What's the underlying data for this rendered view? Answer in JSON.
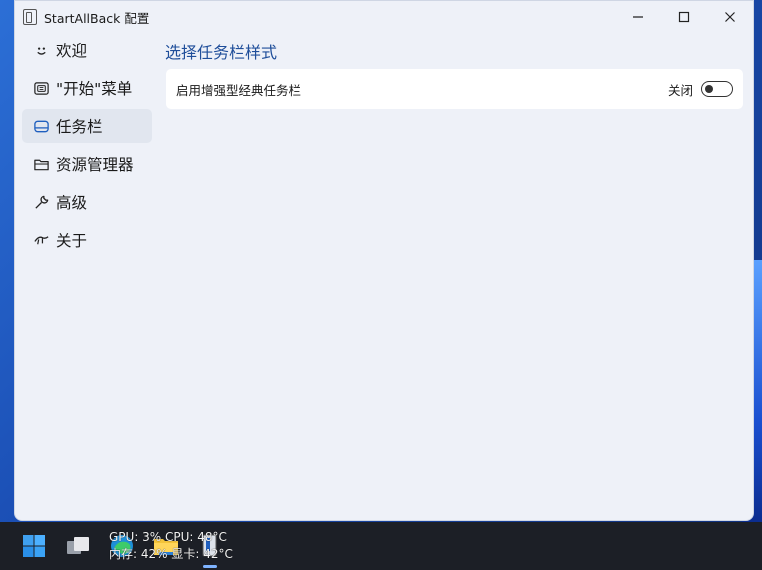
{
  "window": {
    "title": "StartAllBack 配置",
    "controls": {
      "minimize": "minimize",
      "maximize": "maximize",
      "close": "close"
    }
  },
  "sidebar": {
    "items": [
      {
        "label": "欢迎",
        "icon": "smile-icon",
        "active": false
      },
      {
        "label": "\"开始\"菜单",
        "icon": "start-menu-icon",
        "active": false
      },
      {
        "label": "任务栏",
        "icon": "taskbar-icon",
        "active": true
      },
      {
        "label": "资源管理器",
        "icon": "folder-icon",
        "active": false
      },
      {
        "label": "高级",
        "icon": "wrench-icon",
        "active": false
      },
      {
        "label": "关于",
        "icon": "about-icon",
        "active": false
      }
    ]
  },
  "main": {
    "section_title": "选择任务栏样式",
    "setting": {
      "label": "启用增强型经典任务栏",
      "state_text": "关闭",
      "enabled": false
    }
  },
  "taskbar": {
    "sys_info_line1": "GPU: 3%  CPU: 48°C",
    "sys_info_line2": "内存: 42%  显卡: 42°C"
  },
  "colors": {
    "accent": "#1f4e9a",
    "window_bg": "#eef1f8",
    "taskbar_bg": "#1c1f26",
    "active_item_bg": "#e1e6ef"
  }
}
